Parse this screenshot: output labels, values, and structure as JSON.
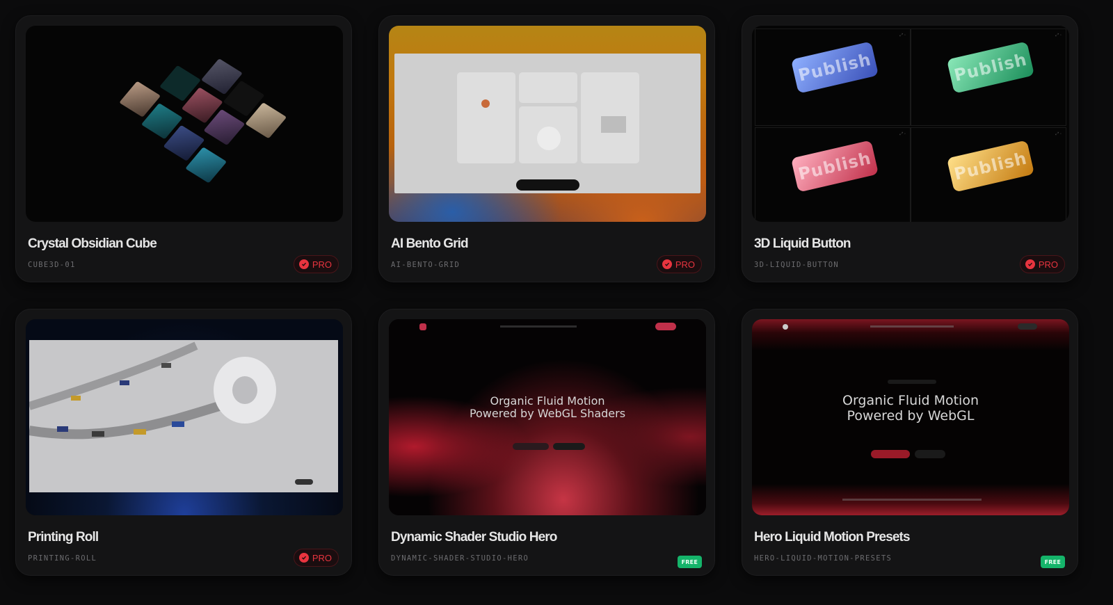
{
  "cards": [
    {
      "title": "Crystal Obsidian Cube",
      "slug": "CUBE3D-01",
      "badge": "PRO"
    },
    {
      "title": "AI Bento Grid",
      "slug": "AI-BENTO-GRID",
      "badge": "PRO"
    },
    {
      "title": "3D Liquid Button",
      "slug": "3D-LIQUID-BUTTON",
      "badge": "PRO"
    },
    {
      "title": "Printing Roll",
      "slug": "PRINTING-ROLL",
      "badge": "PRO"
    },
    {
      "title": "Dynamic Shader Studio Hero",
      "slug": "DYNAMIC-SHADER-STUDIO-HERO",
      "badge": "FREE"
    },
    {
      "title": "Hero Liquid Motion Presets",
      "slug": "HERO-LIQUID-MOTION-PRESETS",
      "badge": "FREE"
    }
  ],
  "previews": {
    "liquid_button_label": "Publish",
    "shader_hero_line1": "Organic Fluid Motion",
    "shader_hero_line2": "Powered by WebGL Shaders",
    "motion_hero_line1": "Organic Fluid Motion",
    "motion_hero_line2": "Powered by WebGL"
  },
  "colors": {
    "pro_badge": "#e8343f",
    "free_badge": "#15b46a",
    "background": "#0b0b0c"
  }
}
